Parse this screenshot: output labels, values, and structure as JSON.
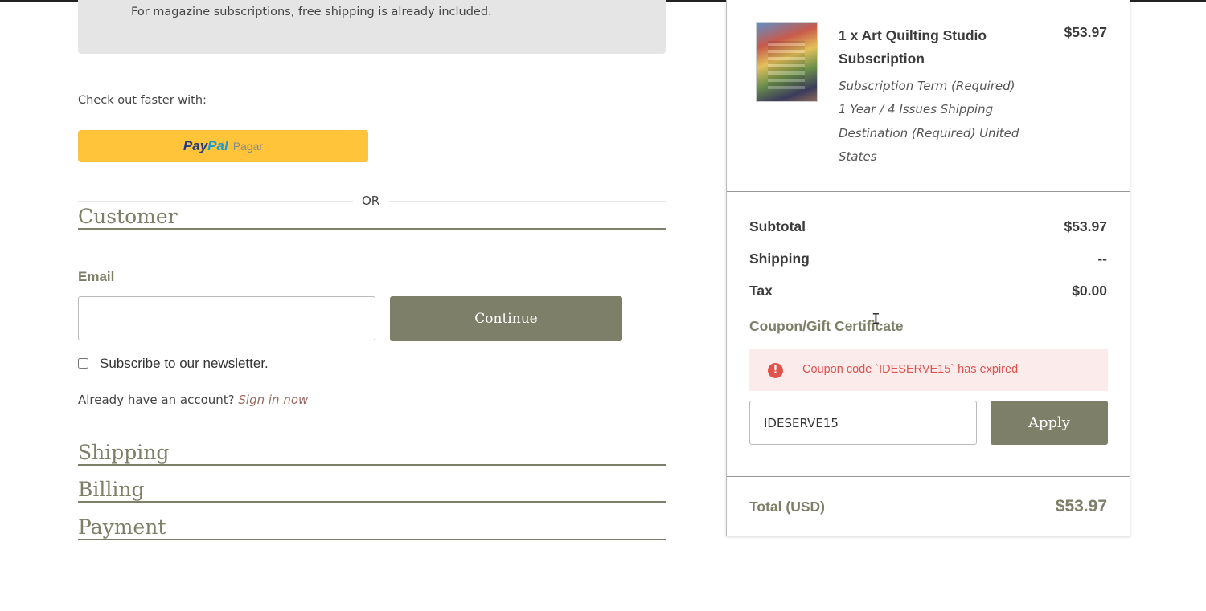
{
  "notice": {
    "text": "For magazine subscriptions, free shipping is already included."
  },
  "express": {
    "label": "Check out faster with:",
    "paypal_logo_pay": "Pay",
    "paypal_logo_pal": "Pal",
    "paypal_action": "Pagar",
    "or_text": "OR"
  },
  "customer": {
    "title": "Customer",
    "email_label": "Email",
    "email_value": "",
    "continue_label": "Continue",
    "newsletter_label": "Subscribe to our newsletter.",
    "newsletter_checked": false,
    "account_prompt": "Already have an account?",
    "signin_label": "Sign in now"
  },
  "steps": {
    "shipping": "Shipping",
    "billing": "Billing",
    "payment": "Payment"
  },
  "summary": {
    "item": {
      "name": "1 x Art Quilting Studio Subscription",
      "price": "$53.97",
      "options": "Subscription Term (Required) 1 Year / 4 Issues Shipping Destination (Required) United States"
    },
    "subtotal_label": "Subtotal",
    "subtotal_value": "$53.97",
    "shipping_label": "Shipping",
    "shipping_value": "--",
    "tax_label": "Tax",
    "tax_value": "$0.00",
    "coupon_label": "Coupon/Gift Certificate",
    "error_icon": "!",
    "error_text": "Coupon code `IDESERVE15` has expired",
    "coupon_value": "IDESERVE15",
    "apply_label": "Apply",
    "total_label": "Total (USD)",
    "total_value": "$53.97"
  },
  "colors": {
    "accent": "#7e7f68",
    "paypal": "#ffc439",
    "error": "#e0534d",
    "error_bg": "#fcebeb",
    "notice_bg": "#e5e5e5"
  },
  "icons": {
    "error": "alert-circle-icon",
    "cursor": "text-cursor-icon"
  }
}
